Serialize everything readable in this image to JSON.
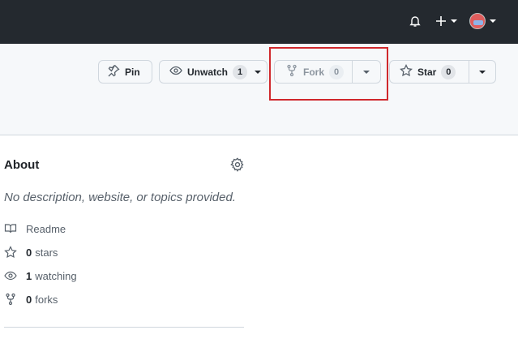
{
  "topbar": {
    "notifications_icon": "bell-icon",
    "create_icon": "plus-icon",
    "avatar_icon": "user-avatar"
  },
  "repo_actions": {
    "pin_label": "Pin",
    "unwatch_label": "Unwatch",
    "watch_count": "1",
    "fork_label": "Fork",
    "fork_count": "0",
    "star_label": "Star",
    "star_count": "0"
  },
  "about": {
    "title": "About",
    "description": "No description, website, or topics provided.",
    "items": [
      {
        "icon": "book-icon",
        "count": "",
        "label": "Readme"
      },
      {
        "icon": "star-icon",
        "count": "0",
        "label": "stars"
      },
      {
        "icon": "eye-icon",
        "count": "1",
        "label": "watching"
      },
      {
        "icon": "fork-icon",
        "count": "0",
        "label": "forks"
      }
    ]
  },
  "colors": {
    "topbar_bg": "#24292f",
    "highlight_border": "#d0282c"
  }
}
